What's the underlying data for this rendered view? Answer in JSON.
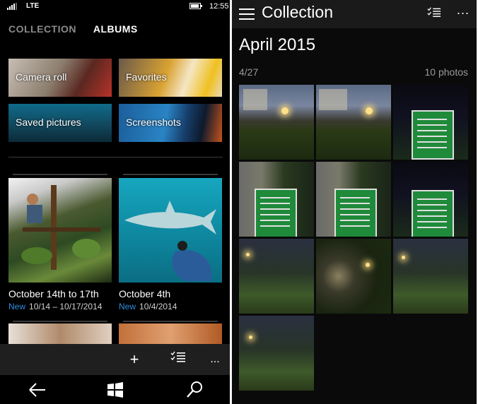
{
  "left_panel": {
    "status_bar": {
      "network": "LTE",
      "time": "12:55"
    },
    "pivot": {
      "tab_collection": "COLLECTION",
      "tab_albums": "ALBUMS"
    },
    "albums": {
      "camera_roll": "Camera roll",
      "favorites": "Favorites",
      "saved_pictures": "Saved pictures",
      "screenshots": "Screenshots"
    },
    "event_albums": [
      {
        "title": "October 14th to 17th",
        "badge": "New",
        "dates": "10/14 – 10/17/2014"
      },
      {
        "title": "October 4th",
        "badge": "New",
        "dates": "10/4/2014"
      }
    ],
    "command_bar": {
      "add_icon": "+",
      "more_icon": "..."
    }
  },
  "right_panel": {
    "header": {
      "title": "Collection",
      "more_icon": "..."
    },
    "month": "April 2015",
    "date": "4/27",
    "count": "10 photos"
  },
  "colors": {
    "accent": "#2e8de0",
    "background": "#000000",
    "command_bar": "#1f1f1f"
  }
}
